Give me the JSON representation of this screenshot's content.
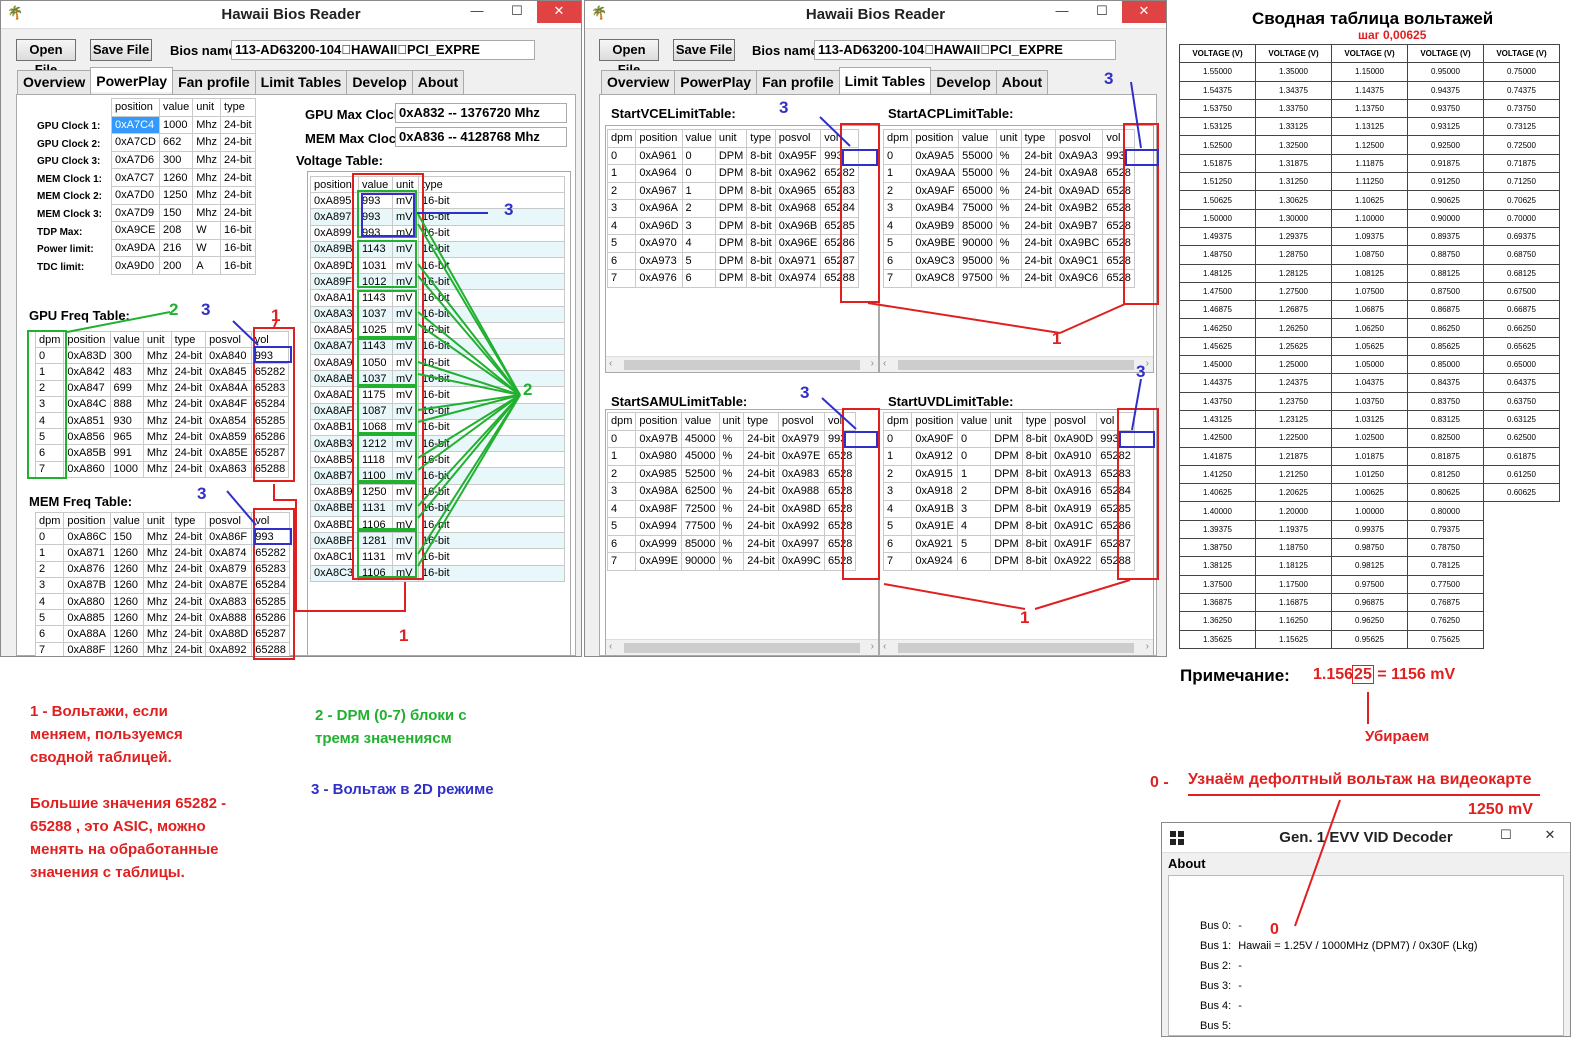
{
  "app": {
    "title": "Hawaii Bios Reader",
    "open_file": "Open File",
    "save_file": "Save File",
    "bios_label": "Bios name",
    "bios_value": "113-AD63200-104\u0000HAWAII\u0000PCI_EXPRE",
    "minimize": "—",
    "maximize": "☐",
    "close": "✕"
  },
  "tabs": [
    "Overview",
    "PowerPlay",
    "Fan profile",
    "Limit Tables",
    "Develop",
    "About"
  ],
  "left": {
    "clock_headers": [
      "position",
      "value",
      "unit",
      "type"
    ],
    "clock_labels": [
      "GPU Clock 1:",
      "GPU Clock 2:",
      "GPU Clock 3:",
      "MEM Clock 1:",
      "MEM Clock 2:",
      "MEM Clock 3:",
      "TDP Max:",
      "Power limit:",
      "TDC limit:"
    ],
    "clock_rows": [
      [
        "0xA7C4",
        "1000",
        "Mhz",
        "24-bit"
      ],
      [
        "0xA7CD",
        "662",
        "Mhz",
        "24-bit"
      ],
      [
        "0xA7D6",
        "300",
        "Mhz",
        "24-bit"
      ],
      [
        "0xA7C7",
        "1260",
        "Mhz",
        "24-bit"
      ],
      [
        "0xA7D0",
        "1250",
        "Mhz",
        "24-bit"
      ],
      [
        "0xA7D9",
        "150",
        "Mhz",
        "24-bit"
      ],
      [
        "0xA9CE",
        "208",
        "W",
        "16-bit"
      ],
      [
        "0xA9DA",
        "216",
        "W",
        "16-bit"
      ],
      [
        "0xA9D0",
        "200",
        "A",
        "16-bit"
      ]
    ],
    "gpu_max_label": "GPU Max Clock",
    "gpu_max_value": "0xA832 -- 1376720 Mhz",
    "mem_max_label": "MEM Max Clock",
    "mem_max_value": "0xA836 -- 4128768 Mhz",
    "voltage_title": "Voltage Table:",
    "voltage_headers": [
      "position",
      "value",
      "unit",
      "type"
    ],
    "voltage_rows": [
      [
        "0xA895",
        "993",
        "mV",
        "16-bit"
      ],
      [
        "0xA897",
        "993",
        "mV",
        "16-bit"
      ],
      [
        "0xA899",
        "993",
        "mV",
        "16-bit"
      ],
      [
        "0xA89B",
        "1143",
        "mV",
        "16-bit"
      ],
      [
        "0xA89D",
        "1031",
        "mV",
        "16-bit"
      ],
      [
        "0xA89F",
        "1012",
        "mV",
        "16-bit"
      ],
      [
        "0xA8A1",
        "1143",
        "mV",
        "16-bit"
      ],
      [
        "0xA8A3",
        "1037",
        "mV",
        "16-bit"
      ],
      [
        "0xA8A5",
        "1025",
        "mV",
        "16-bit"
      ],
      [
        "0xA8A7",
        "1143",
        "mV",
        "16-bit"
      ],
      [
        "0xA8A9",
        "1050",
        "mV",
        "16-bit"
      ],
      [
        "0xA8AB",
        "1037",
        "mV",
        "16-bit"
      ],
      [
        "0xA8AD",
        "1175",
        "mV",
        "16-bit"
      ],
      [
        "0xA8AF",
        "1087",
        "mV",
        "16-bit"
      ],
      [
        "0xA8B1",
        "1068",
        "mV",
        "16-bit"
      ],
      [
        "0xA8B3",
        "1212",
        "mV",
        "16-bit"
      ],
      [
        "0xA8B5",
        "1118",
        "mV",
        "16-bit"
      ],
      [
        "0xA8B7",
        "1100",
        "mV",
        "16-bit"
      ],
      [
        "0xA8B9",
        "1250",
        "mV",
        "16-bit"
      ],
      [
        "0xA8BB",
        "1131",
        "mV",
        "16-bit"
      ],
      [
        "0xA8BD",
        "1106",
        "mV",
        "16-bit"
      ],
      [
        "0xA8BF",
        "1281",
        "mV",
        "16-bit"
      ],
      [
        "0xA8C1",
        "1131",
        "mV",
        "16-bit"
      ],
      [
        "0xA8C3",
        "1106",
        "mV",
        "16-bit"
      ]
    ],
    "gpu_freq_title": "GPU Freq Table:",
    "freq_headers": [
      "dpm",
      "position",
      "value",
      "unit",
      "type",
      "posvol",
      "vol"
    ],
    "gpu_freq_rows": [
      [
        "0",
        "0xA83D",
        "300",
        "Mhz",
        "24-bit",
        "0xA840",
        "993"
      ],
      [
        "1",
        "0xA842",
        "483",
        "Mhz",
        "24-bit",
        "0xA845",
        "65282"
      ],
      [
        "2",
        "0xA847",
        "699",
        "Mhz",
        "24-bit",
        "0xA84A",
        "65283"
      ],
      [
        "3",
        "0xA84C",
        "888",
        "Mhz",
        "24-bit",
        "0xA84F",
        "65284"
      ],
      [
        "4",
        "0xA851",
        "930",
        "Mhz",
        "24-bit",
        "0xA854",
        "65285"
      ],
      [
        "5",
        "0xA856",
        "965",
        "Mhz",
        "24-bit",
        "0xA859",
        "65286"
      ],
      [
        "6",
        "0xA85B",
        "991",
        "Mhz",
        "24-bit",
        "0xA85E",
        "65287"
      ],
      [
        "7",
        "0xA860",
        "1000",
        "Mhz",
        "24-bit",
        "0xA863",
        "65288"
      ]
    ],
    "mem_freq_title": "MEM Freq Table:",
    "mem_freq_rows": [
      [
        "0",
        "0xA86C",
        "150",
        "Mhz",
        "24-bit",
        "0xA86F",
        "993"
      ],
      [
        "1",
        "0xA871",
        "1260",
        "Mhz",
        "24-bit",
        "0xA874",
        "65282"
      ],
      [
        "2",
        "0xA876",
        "1260",
        "Mhz",
        "24-bit",
        "0xA879",
        "65283"
      ],
      [
        "3",
        "0xA87B",
        "1260",
        "Mhz",
        "24-bit",
        "0xA87E",
        "65284"
      ],
      [
        "4",
        "0xA880",
        "1260",
        "Mhz",
        "24-bit",
        "0xA883",
        "65285"
      ],
      [
        "5",
        "0xA885",
        "1260",
        "Mhz",
        "24-bit",
        "0xA888",
        "65286"
      ],
      [
        "6",
        "0xA88A",
        "1260",
        "Mhz",
        "24-bit",
        "0xA88D",
        "65287"
      ],
      [
        "7",
        "0xA88F",
        "1260",
        "Mhz",
        "24-bit",
        "0xA892",
        "65288"
      ]
    ]
  },
  "right": {
    "headers": [
      "dpm",
      "position",
      "value",
      "unit",
      "type",
      "posvol",
      "vol"
    ],
    "vce_title": "StartVCELimitTable:",
    "vce_rows": [
      [
        "0",
        "0xA961",
        "0",
        "DPM",
        "8-bit",
        "0xA95F",
        "993"
      ],
      [
        "1",
        "0xA964",
        "0",
        "DPM",
        "8-bit",
        "0xA962",
        "65282"
      ],
      [
        "2",
        "0xA967",
        "1",
        "DPM",
        "8-bit",
        "0xA965",
        "65283"
      ],
      [
        "3",
        "0xA96A",
        "2",
        "DPM",
        "8-bit",
        "0xA968",
        "65284"
      ],
      [
        "4",
        "0xA96D",
        "3",
        "DPM",
        "8-bit",
        "0xA96B",
        "65285"
      ],
      [
        "5",
        "0xA970",
        "4",
        "DPM",
        "8-bit",
        "0xA96E",
        "65286"
      ],
      [
        "6",
        "0xA973",
        "5",
        "DPM",
        "8-bit",
        "0xA971",
        "65287"
      ],
      [
        "7",
        "0xA976",
        "6",
        "DPM",
        "8-bit",
        "0xA974",
        "65288"
      ]
    ],
    "acp_title": "StartACPLimitTable:",
    "acp_rows": [
      [
        "0",
        "0xA9A5",
        "55000",
        "%",
        "24-bit",
        "0xA9A3",
        "993"
      ],
      [
        "1",
        "0xA9AA",
        "55000",
        "%",
        "24-bit",
        "0xA9A8",
        "6528"
      ],
      [
        "2",
        "0xA9AF",
        "65000",
        "%",
        "24-bit",
        "0xA9AD",
        "6528"
      ],
      [
        "3",
        "0xA9B4",
        "75000",
        "%",
        "24-bit",
        "0xA9B2",
        "6528"
      ],
      [
        "4",
        "0xA9B9",
        "85000",
        "%",
        "24-bit",
        "0xA9B7",
        "6528"
      ],
      [
        "5",
        "0xA9BE",
        "90000",
        "%",
        "24-bit",
        "0xA9BC",
        "6528"
      ],
      [
        "6",
        "0xA9C3",
        "95000",
        "%",
        "24-bit",
        "0xA9C1",
        "6528"
      ],
      [
        "7",
        "0xA9C8",
        "97500",
        "%",
        "24-bit",
        "0xA9C6",
        "6528"
      ]
    ],
    "samu_title": "StartSAMULimitTable:",
    "samu_rows": [
      [
        "0",
        "0xA97B",
        "45000",
        "%",
        "24-bit",
        "0xA979",
        "993"
      ],
      [
        "1",
        "0xA980",
        "45000",
        "%",
        "24-bit",
        "0xA97E",
        "6528"
      ],
      [
        "2",
        "0xA985",
        "52500",
        "%",
        "24-bit",
        "0xA983",
        "6528"
      ],
      [
        "3",
        "0xA98A",
        "62500",
        "%",
        "24-bit",
        "0xA988",
        "6528"
      ],
      [
        "4",
        "0xA98F",
        "72500",
        "%",
        "24-bit",
        "0xA98D",
        "6528"
      ],
      [
        "5",
        "0xA994",
        "77500",
        "%",
        "24-bit",
        "0xA992",
        "6528"
      ],
      [
        "6",
        "0xA999",
        "85000",
        "%",
        "24-bit",
        "0xA997",
        "6528"
      ],
      [
        "7",
        "0xA99E",
        "90000",
        "%",
        "24-bit",
        "0xA99C",
        "6528"
      ]
    ],
    "uvd_title": "StartUVDLimitTable:",
    "uvd_rows": [
      [
        "0",
        "0xA90F",
        "0",
        "DPM",
        "8-bit",
        "0xA90D",
        "993"
      ],
      [
        "1",
        "0xA912",
        "0",
        "DPM",
        "8-bit",
        "0xA910",
        "65282"
      ],
      [
        "2",
        "0xA915",
        "1",
        "DPM",
        "8-bit",
        "0xA913",
        "65283"
      ],
      [
        "3",
        "0xA918",
        "2",
        "DPM",
        "8-bit",
        "0xA916",
        "65284"
      ],
      [
        "4",
        "0xA91B",
        "3",
        "DPM",
        "8-bit",
        "0xA919",
        "65285"
      ],
      [
        "5",
        "0xA91E",
        "4",
        "DPM",
        "8-bit",
        "0xA91C",
        "65286"
      ],
      [
        "6",
        "0xA921",
        "5",
        "DPM",
        "8-bit",
        "0xA91F",
        "65287"
      ],
      [
        "7",
        "0xA924",
        "6",
        "DPM",
        "8-bit",
        "0xA922",
        "65288"
      ]
    ]
  },
  "summary": {
    "title": "Сводная таблица вольтажей",
    "step": "шаг 0,00625",
    "header": "VOLTAGE (V)",
    "columns": [
      [
        "1.55000",
        "1.54375",
        "1.53750",
        "1.53125",
        "1.52500",
        "1.51875",
        "1.51250",
        "1.50625",
        "1.50000",
        "1.49375",
        "1.48750",
        "1.48125",
        "1.47500",
        "1.46875",
        "1.46250",
        "1.45625",
        "1.45000",
        "1.44375",
        "1.43750",
        "1.43125",
        "1.42500",
        "1.41875",
        "1.41250",
        "1.40625",
        "1.40000",
        "1.39375",
        "1.38750",
        "1.38125",
        "1.37500",
        "1.36875",
        "1.36250",
        "1.35625"
      ],
      [
        "1.35000",
        "1.34375",
        "1.33750",
        "1.33125",
        "1.32500",
        "1.31875",
        "1.31250",
        "1.30625",
        "1.30000",
        "1.29375",
        "1.28750",
        "1.28125",
        "1.27500",
        "1.26875",
        "1.26250",
        "1.25625",
        "1.25000",
        "1.24375",
        "1.23750",
        "1.23125",
        "1.22500",
        "1.21875",
        "1.21250",
        "1.20625",
        "1.20000",
        "1.19375",
        "1.18750",
        "1.18125",
        "1.17500",
        "1.16875",
        "1.16250",
        "1.15625"
      ],
      [
        "1.15000",
        "1.14375",
        "1.13750",
        "1.13125",
        "1.12500",
        "1.11875",
        "1.11250",
        "1.10625",
        "1.10000",
        "1.09375",
        "1.08750",
        "1.08125",
        "1.07500",
        "1.06875",
        "1.06250",
        "1.05625",
        "1.05000",
        "1.04375",
        "1.03750",
        "1.03125",
        "1.02500",
        "1.01875",
        "1.01250",
        "1.00625",
        "1.00000",
        "0.99375",
        "0.98750",
        "0.98125",
        "0.97500",
        "0.96875",
        "0.96250",
        "0.95625"
      ],
      [
        "0.95000",
        "0.94375",
        "0.93750",
        "0.93125",
        "0.92500",
        "0.91875",
        "0.91250",
        "0.90625",
        "0.90000",
        "0.89375",
        "0.88750",
        "0.88125",
        "0.87500",
        "0.86875",
        "0.86250",
        "0.85625",
        "0.85000",
        "0.84375",
        "0.83750",
        "0.83125",
        "0.82500",
        "0.81875",
        "0.81250",
        "0.80625",
        "0.80000",
        "0.79375",
        "0.78750",
        "0.78125",
        "0.77500",
        "0.76875",
        "0.76250",
        "0.75625"
      ],
      [
        "0.75000",
        "0.74375",
        "0.73750",
        "0.73125",
        "0.72500",
        "0.71875",
        "0.71250",
        "0.70625",
        "0.70000",
        "0.69375",
        "0.68750",
        "0.68125",
        "0.67500",
        "0.66875",
        "0.66250",
        "0.65625",
        "0.65000",
        "0.64375",
        "0.63750",
        "0.63125",
        "0.62500",
        "0.61875",
        "0.61250",
        "0.60625"
      ]
    ]
  },
  "note": {
    "label": "Примечание:",
    "value_a": "1.156",
    "value_b": "25",
    "value_c": "= 1156 mV",
    "remove": "Убираем"
  },
  "evv": {
    "step0": "0 -",
    "text": "Узнаём дефолтный вольтаж на видеокарте",
    "mv": "1250 mV",
    "title": "Gen. 1 EVV VID Decoder",
    "menu": "About",
    "marker": "0",
    "buses": [
      [
        "Bus  0:",
        "-"
      ],
      [
        "Bus  1:",
        "Hawaii = 1.25V / 1000MHz (DPM7) / 0x30F (Lkg)"
      ],
      [
        "Bus  2:",
        "-"
      ],
      [
        "Bus  3:",
        "-"
      ],
      [
        "Bus  4:",
        "-"
      ],
      [
        "Bus  5:",
        ""
      ]
    ]
  },
  "annotations": {
    "n1": "1",
    "n2": "2",
    "n3": "3",
    "legend1": [
      "1 - Вольтажи, если",
      "меняем, пользуемся",
      "сводной таблицей.",
      "",
      "Большие значения 65282 -",
      "65288 , это ASIC, можно",
      "менять на обработанные",
      "значения с таблицы."
    ],
    "legend2": [
      "2 - DPM (0-7) блоки с",
      "тремя значениясм"
    ],
    "legend3": "3 - Вольтаж в 2D режиме"
  },
  "colors": {
    "red": "#e02020",
    "green": "#22b030",
    "blue": "#3030c8",
    "selection": "#3399ff"
  }
}
